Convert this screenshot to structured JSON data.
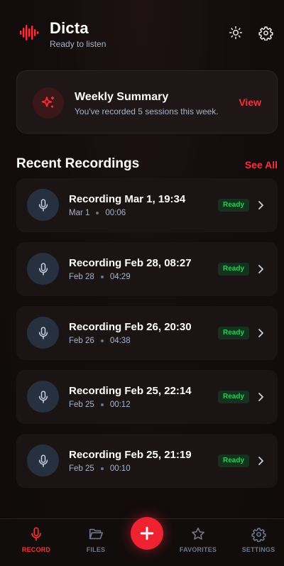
{
  "app": {
    "title": "Dicta",
    "status": "Ready to listen",
    "accent": "#ff2d3a"
  },
  "header": {
    "theme_icon": "sun-icon",
    "settings_icon": "gear-icon"
  },
  "summary": {
    "icon": "sparkles-icon",
    "title": "Weekly Summary",
    "text": "You've recorded 5 sessions this week.",
    "action": "View"
  },
  "recent": {
    "title": "Recent Recordings",
    "see_all": "See All",
    "items": [
      {
        "title": "Recording Mar 1, 19:34",
        "date": "Mar 1",
        "duration": "00:06",
        "status": "Ready"
      },
      {
        "title": "Recording Feb 28, 08:27",
        "date": "Feb 28",
        "duration": "04:29",
        "status": "Ready"
      },
      {
        "title": "Recording Feb 26, 20:30",
        "date": "Feb 26",
        "duration": "04:38",
        "status": "Ready"
      },
      {
        "title": "Recording Feb 25, 22:14",
        "date": "Feb 25",
        "duration": "00:12",
        "status": "Ready"
      },
      {
        "title": "Recording Feb 25, 21:19",
        "date": "Feb 25",
        "duration": "00:10",
        "status": "Ready"
      }
    ]
  },
  "nav": {
    "record": "RECORD",
    "files": "FILES",
    "favorites": "FAVORITES",
    "settings": "SETTINGS",
    "fab_icon": "plus-icon"
  }
}
